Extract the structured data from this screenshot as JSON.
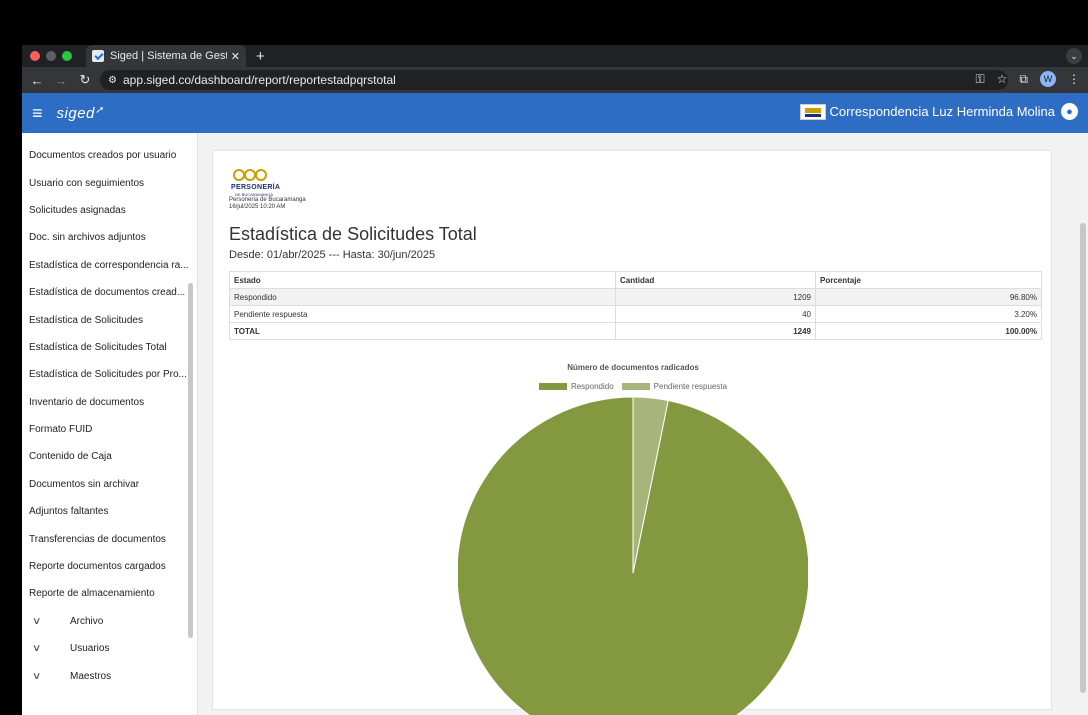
{
  "browser": {
    "tab_title": "Siged | Sistema de Gestión D",
    "url": "app.siged.co/dashboard/report/reportestadpqrstotal",
    "profile_initial": "W"
  },
  "app": {
    "logo_text": "siged",
    "user_name": "Correspondencia Luz Herminda Molina"
  },
  "sidebar": {
    "items": [
      "Documentos creados por usuario",
      "Usuario con seguimientos",
      "Solicitudes asignadas",
      "Doc. sin archivos adjuntos",
      "Estadística de correspondencia ra...",
      "Estadística de documentos cread...",
      "Estadística de Solicitudes",
      "Estadística de Solicitudes Total",
      "Estadística de Solicitudes por Pro...",
      "Inventario de documentos",
      "Formato FUID",
      "Contenido de Caja",
      "Documentos sin archivar",
      "Adjuntos faltantes",
      "Transferencias de documentos",
      "Reporte documentos cargados",
      "Reporte de almacenamiento"
    ],
    "groups": [
      "Archivo",
      "Usuarios",
      "Maestros"
    ]
  },
  "report": {
    "logo_word": "PERSONERÍA",
    "logo_sub": "DE BUCARAMANGA",
    "org_name": "Personería de Bucaramanga",
    "generated": "16/jul/2025 10:20 AM",
    "title": "Estadística de Solicitudes Total",
    "range": "Desde: 01/abr/2025 --- Hasta: 30/jun/2025",
    "table": {
      "headers": [
        "Estado",
        "Cantidad",
        "Porcentaje"
      ],
      "rows": [
        [
          "Respondido",
          "1209",
          "96.80%"
        ],
        [
          "Pendiente respuesta",
          "40",
          "3.20%"
        ]
      ],
      "total": [
        "TOTAL",
        "1249",
        "100.00%"
      ]
    }
  },
  "chart_data": {
    "type": "pie",
    "title": "Número de documentos radicados",
    "categories": [
      "Respondido",
      "Pendiente respuesta"
    ],
    "values": [
      1209,
      40
    ],
    "colors": [
      "#84993f",
      "#a8b57a"
    ],
    "legend": "top"
  }
}
